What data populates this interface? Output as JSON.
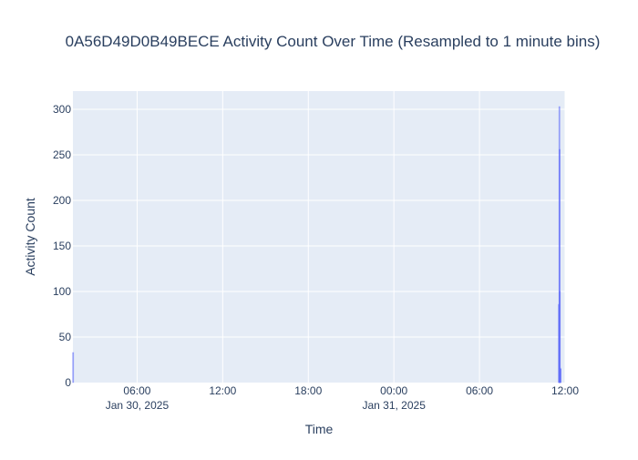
{
  "chart_data": {
    "type": "bar",
    "title": "0A56D49D0B49BECE Activity Count Over Time (Resampled to 1 minute bins)",
    "xlabel": "Time",
    "ylabel": "Activity Count",
    "x_range": [
      "2025-01-30 01:30",
      "2025-01-31 12:00"
    ],
    "ylim": [
      0,
      320
    ],
    "y_ticks": [
      0,
      50,
      100,
      150,
      200,
      250,
      300
    ],
    "x_ticks": [
      {
        "at": "2025-01-30 06:00",
        "label": "06:00",
        "sublabel": "Jan 30, 2025"
      },
      {
        "at": "2025-01-30 12:00",
        "label": "12:00",
        "sublabel": ""
      },
      {
        "at": "2025-01-30 18:00",
        "label": "18:00",
        "sublabel": ""
      },
      {
        "at": "2025-01-31 00:00",
        "label": "00:00",
        "sublabel": "Jan 31, 2025"
      },
      {
        "at": "2025-01-31 06:00",
        "label": "06:00",
        "sublabel": ""
      },
      {
        "at": "2025-01-31 12:00",
        "label": "12:00",
        "sublabel": ""
      }
    ],
    "grid": true,
    "bar_color": "#636efa",
    "plot_bg": "#e5ecf6",
    "points": [
      {
        "x": "2025-01-30 01:31",
        "y": 33
      },
      {
        "x": "2025-01-31 11:34",
        "y": 86
      },
      {
        "x": "2025-01-31 11:35",
        "y": 85
      },
      {
        "x": "2025-01-31 11:36",
        "y": 303
      },
      {
        "x": "2025-01-31 11:37",
        "y": 256
      },
      {
        "x": "2025-01-31 11:38",
        "y": 100
      },
      {
        "x": "2025-01-31 11:39",
        "y": 16
      },
      {
        "x": "2025-01-31 11:40",
        "y": 15
      },
      {
        "x": "2025-01-31 11:41",
        "y": 15
      }
    ]
  }
}
